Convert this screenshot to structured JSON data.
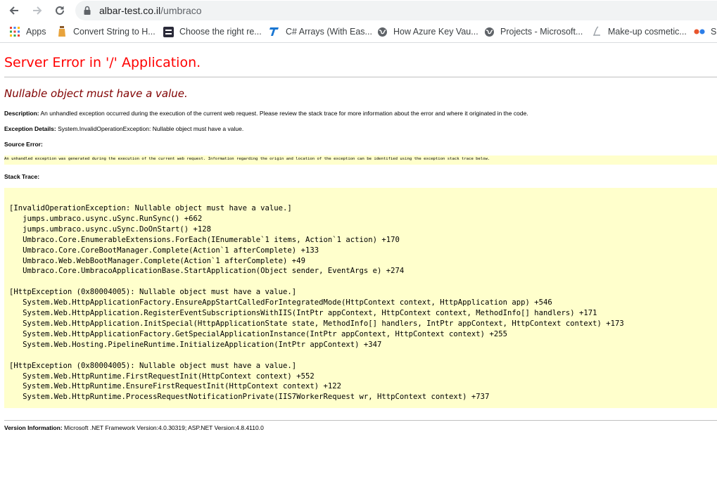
{
  "browser": {
    "url_host": "albar-test.co.il",
    "url_path": "/umbraco",
    "bookmarks": [
      {
        "label": "Apps",
        "icon": "apps-grid-icon"
      },
      {
        "label": "Convert String to H...",
        "icon": "jar-icon"
      },
      {
        "label": "Choose the right re...",
        "icon": "app-icon"
      },
      {
        "label": "C# Arrays (With Eas...",
        "icon": "t-logo-icon"
      },
      {
        "label": "How Azure Key Vau...",
        "icon": "globe-icon"
      },
      {
        "label": "Projects - Microsoft...",
        "icon": "globe-icon"
      },
      {
        "label": "Make-up cosmetic...",
        "icon": "l-logo-icon"
      },
      {
        "label": "S",
        "icon": "eyes-icon"
      }
    ]
  },
  "page": {
    "title": "Server Error in '/' Application.",
    "subtitle": "Nullable object must have a value.",
    "description_label": "Description:",
    "description_text": "An unhandled exception occurred during the execution of the current web request. Please review the stack trace for more information about the error and where it originated in the code.",
    "exception_label": "Exception Details:",
    "exception_text": "System.InvalidOperationException: Nullable object must have a value.",
    "source_error_label": "Source Error:",
    "source_error_text": "An unhandled exception was generated during the execution of the current web request. Information regarding the origin and location of the exception can be identified using the exception stack trace below.",
    "stack_trace_label": "Stack Trace:",
    "stack_trace": "[InvalidOperationException: Nullable object must have a value.]\n   jumps.umbraco.usync.uSync.RunSync() +662\n   jumps.umbraco.usync.uSync.DoOnStart() +128\n   Umbraco.Core.EnumerableExtensions.ForEach(IEnumerable`1 items, Action`1 action) +170\n   Umbraco.Core.CoreBootManager.Complete(Action`1 afterComplete) +133\n   Umbraco.Web.WebBootManager.Complete(Action`1 afterComplete) +49\n   Umbraco.Core.UmbracoApplicationBase.StartApplication(Object sender, EventArgs e) +274\n\n[HttpException (0x80004005): Nullable object must have a value.]\n   System.Web.HttpApplicationFactory.EnsureAppStartCalledForIntegratedMode(HttpContext context, HttpApplication app) +546\n   System.Web.HttpApplication.RegisterEventSubscriptionsWithIIS(IntPtr appContext, HttpContext context, MethodInfo[] handlers) +171\n   System.Web.HttpApplication.InitSpecial(HttpApplicationState state, MethodInfo[] handlers, IntPtr appContext, HttpContext context) +173\n   System.Web.HttpApplicationFactory.GetSpecialApplicationInstance(IntPtr appContext, HttpContext context) +255\n   System.Web.Hosting.PipelineRuntime.InitializeApplication(IntPtr appContext) +347\n\n[HttpException (0x80004005): Nullable object must have a value.]\n   System.Web.HttpRuntime.FirstRequestInit(HttpContext context) +552\n   System.Web.HttpRuntime.EnsureFirstRequestInit(HttpContext context) +122\n   System.Web.HttpRuntime.ProcessRequestNotificationPrivate(IIS7WorkerRequest wr, HttpContext context) +737",
    "version_label": "Version Information:",
    "version_text": "Microsoft .NET Framework Version:4.0.30319; ASP.NET Version:4.8.4110.0"
  }
}
